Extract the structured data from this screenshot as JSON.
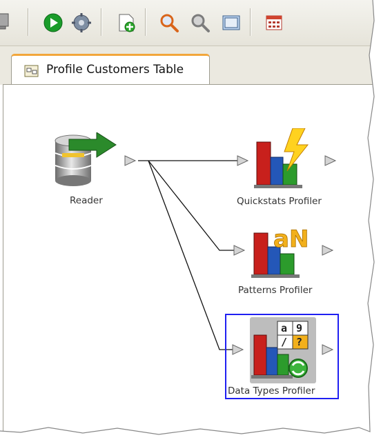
{
  "toolbar": {
    "buttons": [
      {
        "icon": "document-stack-icon"
      },
      {
        "icon": "run-icon"
      },
      {
        "icon": "settings-icon"
      },
      {
        "icon": "new-page-icon"
      },
      {
        "icon": "zoom-in-icon"
      },
      {
        "icon": "zoom-out-icon"
      },
      {
        "icon": "fit-to-window-icon"
      },
      {
        "icon": "calendar-icon"
      }
    ]
  },
  "tab": {
    "label": "Profile Customers Table"
  },
  "nodes": {
    "reader": {
      "label": "Reader"
    },
    "quickstats": {
      "label": "Quickstats Profiler"
    },
    "patterns": {
      "label": "Patterns Profiler"
    },
    "datatypes": {
      "label": "Data Types Profiler",
      "selected": true
    }
  },
  "colors": {
    "selection": "#1f1ff2",
    "tab_accent": "#f2a63b",
    "run_green": "#1a9c2a"
  }
}
